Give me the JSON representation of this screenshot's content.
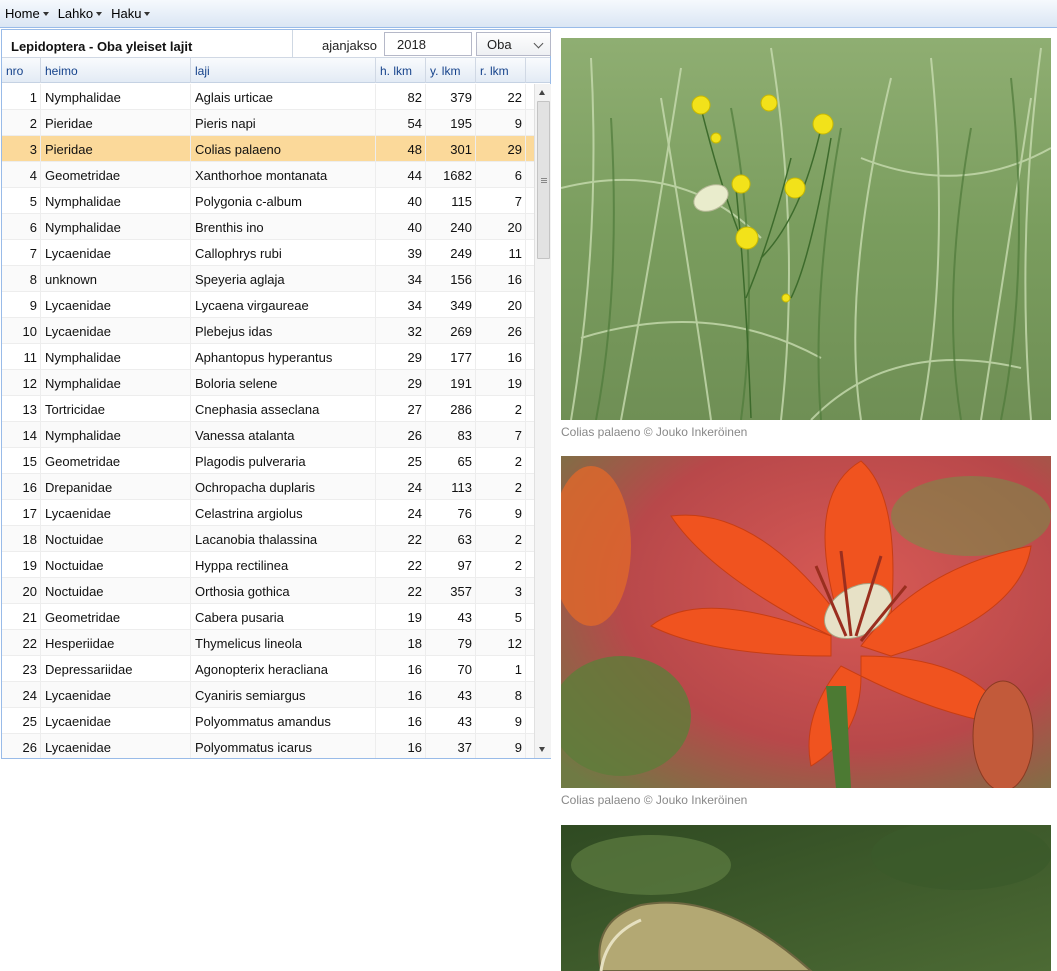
{
  "menu": [
    {
      "label": "Home"
    },
    {
      "label": "Lahko"
    },
    {
      "label": "Haku"
    }
  ],
  "panel": {
    "title": "Lepidoptera - Oba yleiset lajit",
    "period_label": "ajanjakso",
    "year_value": "2018",
    "location_value": "Oba"
  },
  "columns": {
    "nro": "nro",
    "heimo": "heimo",
    "laji": "laji",
    "h_lkm": "h. lkm",
    "y_lkm": "y. lkm",
    "r_lkm": "r. lkm"
  },
  "selected_row": 3,
  "rows": [
    {
      "nro": "1",
      "heimo": "Nymphalidae",
      "laji": "Aglais urticae",
      "h": "82",
      "y": "379",
      "r": "22"
    },
    {
      "nro": "2",
      "heimo": "Pieridae",
      "laji": "Pieris napi",
      "h": "54",
      "y": "195",
      "r": "9"
    },
    {
      "nro": "3",
      "heimo": "Pieridae",
      "laji": "Colias palaeno",
      "h": "48",
      "y": "301",
      "r": "29"
    },
    {
      "nro": "4",
      "heimo": "Geometridae",
      "laji": "Xanthorhoe montanata",
      "h": "44",
      "y": "1682",
      "r": "6"
    },
    {
      "nro": "5",
      "heimo": "Nymphalidae",
      "laji": "Polygonia c-album",
      "h": "40",
      "y": "115",
      "r": "7"
    },
    {
      "nro": "6",
      "heimo": "Nymphalidae",
      "laji": "Brenthis ino",
      "h": "40",
      "y": "240",
      "r": "20"
    },
    {
      "nro": "7",
      "heimo": "Lycaenidae",
      "laji": "Callophrys rubi",
      "h": "39",
      "y": "249",
      "r": "11"
    },
    {
      "nro": "8",
      "heimo": "unknown",
      "laji": "Speyeria aglaja",
      "h": "34",
      "y": "156",
      "r": "16"
    },
    {
      "nro": "9",
      "heimo": "Lycaenidae",
      "laji": "Lycaena virgaureae",
      "h": "34",
      "y": "349",
      "r": "20"
    },
    {
      "nro": "10",
      "heimo": "Lycaenidae",
      "laji": "Plebejus idas",
      "h": "32",
      "y": "269",
      "r": "26"
    },
    {
      "nro": "11",
      "heimo": "Nymphalidae",
      "laji": "Aphantopus hyperantus",
      "h": "29",
      "y": "177",
      "r": "16"
    },
    {
      "nro": "12",
      "heimo": "Nymphalidae",
      "laji": "Boloria selene",
      "h": "29",
      "y": "191",
      "r": "19"
    },
    {
      "nro": "13",
      "heimo": "Tortricidae",
      "laji": "Cnephasia asseclana",
      "h": "27",
      "y": "286",
      "r": "2"
    },
    {
      "nro": "14",
      "heimo": "Nymphalidae",
      "laji": "Vanessa atalanta",
      "h": "26",
      "y": "83",
      "r": "7"
    },
    {
      "nro": "15",
      "heimo": "Geometridae",
      "laji": "Plagodis pulveraria",
      "h": "25",
      "y": "65",
      "r": "2"
    },
    {
      "nro": "16",
      "heimo": "Drepanidae",
      "laji": "Ochropacha duplaris",
      "h": "24",
      "y": "113",
      "r": "2"
    },
    {
      "nro": "17",
      "heimo": "Lycaenidae",
      "laji": "Celastrina argiolus",
      "h": "24",
      "y": "76",
      "r": "9"
    },
    {
      "nro": "18",
      "heimo": "Noctuidae",
      "laji": "Lacanobia thalassina",
      "h": "22",
      "y": "63",
      "r": "2"
    },
    {
      "nro": "19",
      "heimo": "Noctuidae",
      "laji": "Hyppa rectilinea",
      "h": "22",
      "y": "97",
      "r": "2"
    },
    {
      "nro": "20",
      "heimo": "Noctuidae",
      "laji": "Orthosia gothica",
      "h": "22",
      "y": "357",
      "r": "3"
    },
    {
      "nro": "21",
      "heimo": "Geometridae",
      "laji": "Cabera pusaria",
      "h": "19",
      "y": "43",
      "r": "5"
    },
    {
      "nro": "22",
      "heimo": "Hesperiidae",
      "laji": "Thymelicus lineola",
      "h": "18",
      "y": "79",
      "r": "12"
    },
    {
      "nro": "23",
      "heimo": "Depressariidae",
      "laji": "Agonopterix heracliana",
      "h": "16",
      "y": "70",
      "r": "1"
    },
    {
      "nro": "24",
      "heimo": "Lycaenidae",
      "laji": "Cyaniris semiargus",
      "h": "16",
      "y": "43",
      "r": "8"
    },
    {
      "nro": "25",
      "heimo": "Lycaenidae",
      "laji": "Polyommatus amandus",
      "h": "16",
      "y": "43",
      "r": "9"
    },
    {
      "nro": "26",
      "heimo": "Lycaenidae",
      "laji": "Polyommatus icarus",
      "h": "16",
      "y": "37",
      "r": "9"
    }
  ],
  "photos": [
    {
      "caption": "Colias palaeno  © Jouko Inkeröinen"
    },
    {
      "caption": "Colias palaeno  © Jouko Inkeröinen"
    }
  ],
  "colors": {
    "selected_row": "#fbd99a",
    "header_text": "#15428b",
    "border": "#99bbe8"
  }
}
